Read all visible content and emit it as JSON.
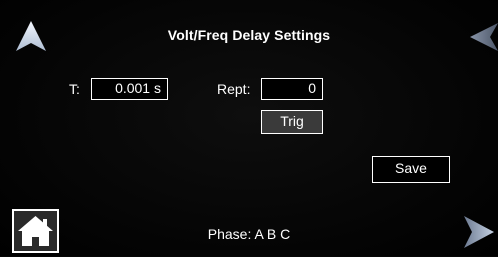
{
  "header": {
    "title": "Volt/Freq Delay Settings",
    "nav_up_icon": "up-arrow-icon",
    "nav_back_icon": "left-arrow-icon"
  },
  "settings": {
    "t_label": "T:",
    "t_value": "0.001 s",
    "rept_label": "Rept:",
    "rept_value": "0",
    "trig_label": "Trig",
    "save_label": "Save"
  },
  "footer": {
    "home_icon": "home-icon",
    "phase_label": "Phase: A B C",
    "nav_next_icon": "right-arrow-icon"
  },
  "colors": {
    "background": "#060606",
    "text": "#ffffff",
    "button_fill": "#3a3a3a",
    "arrow_active": "#dce6f2",
    "arrow_dim": "#5f6b7e"
  }
}
